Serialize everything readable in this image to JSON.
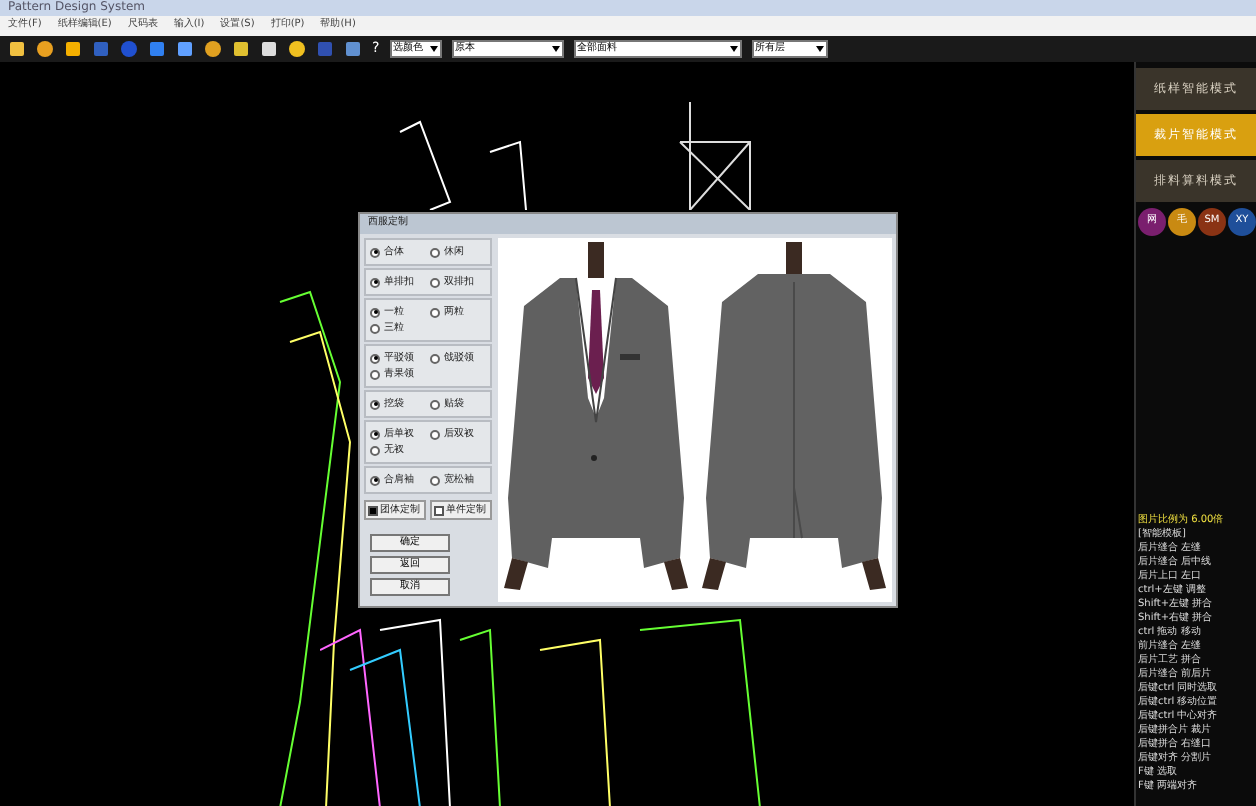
{
  "window": {
    "title": "Pattern Design System"
  },
  "menu": [
    "文件(F)",
    "纸样编辑(E)",
    "尺码表",
    "输入(I)",
    "设置(S)",
    "打印(P)",
    "帮助(H)"
  ],
  "toolbar": {
    "help": "?",
    "dropdowns": [
      {
        "value": "选颜色"
      },
      {
        "value": "原本"
      },
      {
        "value": "全部面料"
      },
      {
        "value": "所有层"
      }
    ]
  },
  "modes": [
    {
      "label": "纸样智能模式",
      "selected": false
    },
    {
      "label": "裁片智能模式",
      "selected": true
    },
    {
      "label": "排料算料模式",
      "selected": false
    }
  ],
  "badges": [
    {
      "label": "网",
      "color": "#7a1f6e"
    },
    {
      "label": "毛",
      "color": "#c98a12"
    },
    {
      "label": "SM",
      "color": "#8a3314"
    },
    {
      "label": "XY",
      "color": "#1f4f9a"
    }
  ],
  "log": {
    "title": "图片比例为 6.00倍",
    "lines": [
      "[智能模板]",
      "后片缝合 左缝",
      "后片缝合 后中线",
      "后片上口 左口",
      "ctrl+左键 调整",
      "Shift+左键 拼合",
      "Shift+右键 拼合",
      "ctrl 拖动 移动",
      "前片缝合 左缝",
      "后片工艺 拼合",
      "后片缝合 前后片",
      "后键ctrl 同时选取",
      "后键ctrl 移动位置",
      "后键ctrl 中心对齐",
      "后键拼合片 裁片",
      "后键拼合 右缝口",
      "后键对齐 分割片",
      "F键 选取",
      "F键 两端对齐"
    ]
  },
  "dialog": {
    "title": "西服定制",
    "groups": [
      {
        "options": [
          {
            "label": "合体",
            "selected": true
          },
          {
            "label": "休闲",
            "selected": false
          }
        ]
      },
      {
        "options": [
          {
            "label": "单排扣",
            "selected": true
          },
          {
            "label": "双排扣",
            "selected": false
          }
        ]
      },
      {
        "options": [
          {
            "label": "一粒",
            "selected": true
          },
          {
            "label": "两粒",
            "selected": false
          },
          {
            "label": "三粒",
            "selected": false
          }
        ]
      },
      {
        "options": [
          {
            "label": "平驳领",
            "selected": true
          },
          {
            "label": "戗驳领",
            "selected": false
          },
          {
            "label": "青果领",
            "selected": false
          }
        ]
      },
      {
        "options": [
          {
            "label": "挖袋",
            "selected": true
          },
          {
            "label": "贴袋",
            "selected": false
          }
        ]
      },
      {
        "options": [
          {
            "label": "后单衩",
            "selected": true
          },
          {
            "label": "后双衩",
            "selected": false
          },
          {
            "label": "无衩",
            "selected": false
          }
        ]
      },
      {
        "options": [
          {
            "label": "合肩袖",
            "selected": true
          },
          {
            "label": "宽松袖",
            "selected": false
          }
        ]
      }
    ],
    "checks": [
      {
        "label": "团体定制",
        "checked": true
      },
      {
        "label": "单件定制",
        "checked": false
      }
    ],
    "buttons": [
      "确定",
      "返回",
      "取消"
    ]
  }
}
